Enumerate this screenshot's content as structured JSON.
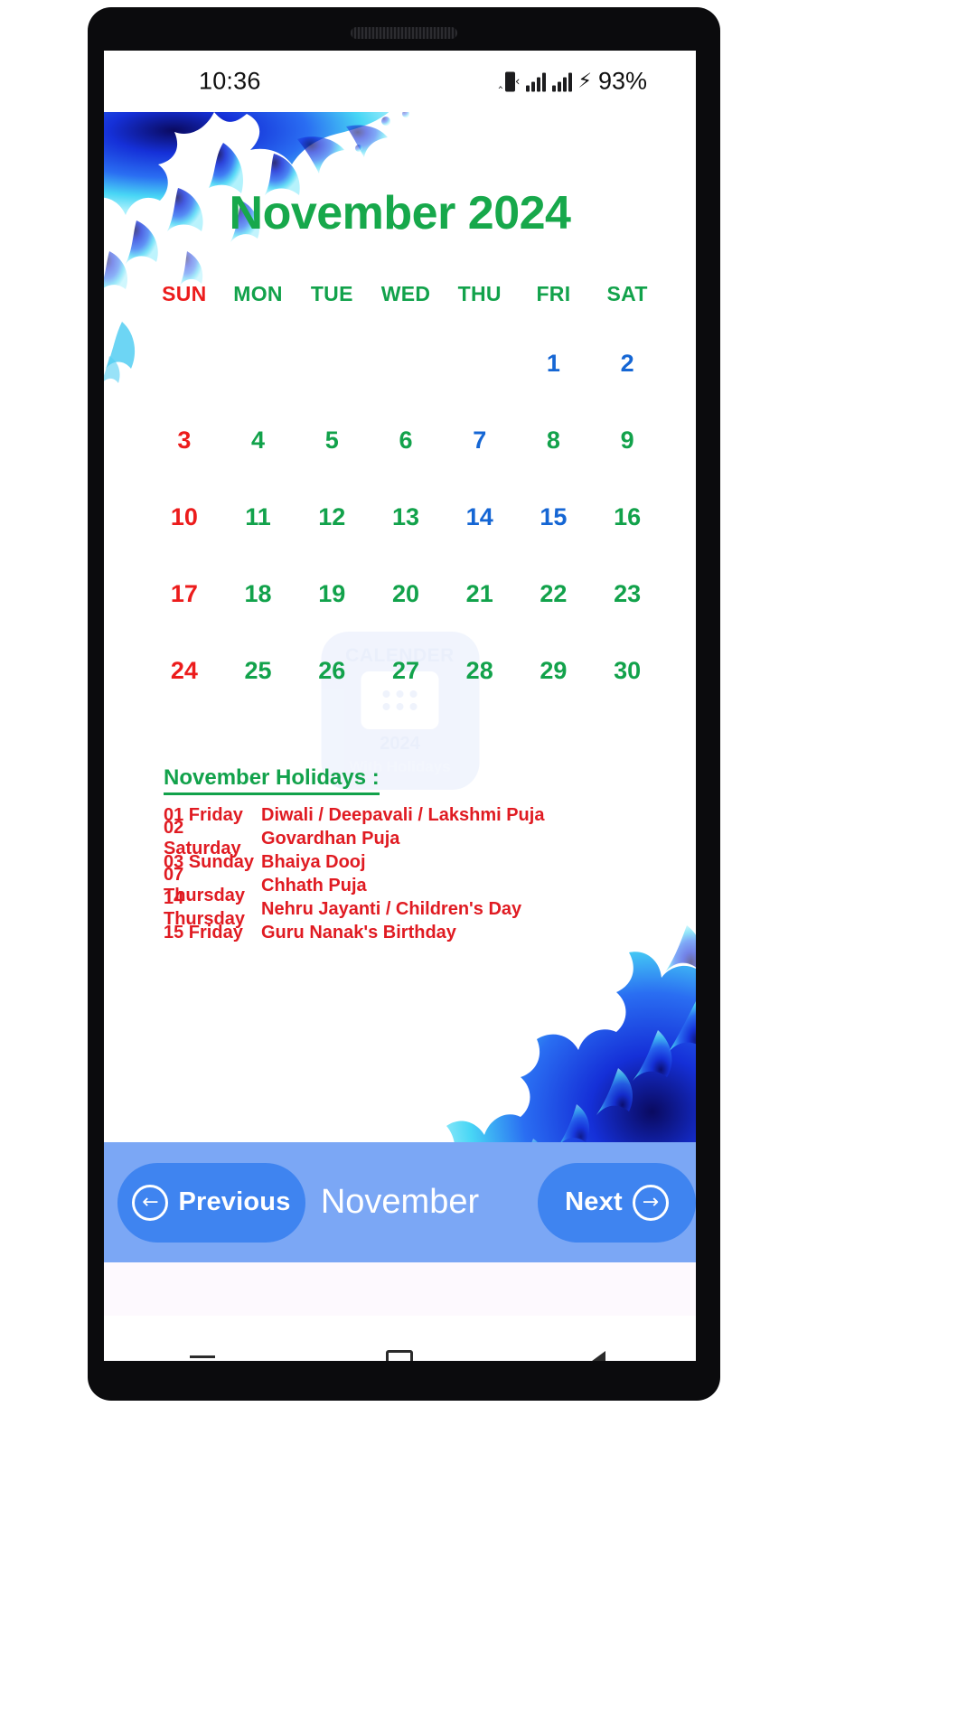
{
  "status_bar": {
    "time": "10:36",
    "battery_percent": "93%",
    "icons": [
      "vibrate-icon",
      "signal-bars-icon",
      "signal-bars-icon",
      "charging-bolt-icon"
    ]
  },
  "calendar": {
    "title": "November 2024",
    "weekdays": [
      {
        "label": "SUN",
        "kind": "sun"
      },
      {
        "label": "MON",
        "kind": "week"
      },
      {
        "label": "TUE",
        "kind": "week"
      },
      {
        "label": "WED",
        "kind": "week"
      },
      {
        "label": "THU",
        "kind": "week"
      },
      {
        "label": "FRI",
        "kind": "week"
      },
      {
        "label": "SAT",
        "kind": "week"
      }
    ],
    "weeks": [
      [
        {
          "d": "",
          "kind": "empty"
        },
        {
          "d": "",
          "kind": "empty"
        },
        {
          "d": "",
          "kind": "empty"
        },
        {
          "d": "",
          "kind": "empty"
        },
        {
          "d": "",
          "kind": "empty"
        },
        {
          "d": "1",
          "kind": "hol"
        },
        {
          "d": "2",
          "kind": "hol"
        }
      ],
      [
        {
          "d": "3",
          "kind": "sun"
        },
        {
          "d": "4",
          "kind": "week"
        },
        {
          "d": "5",
          "kind": "week"
        },
        {
          "d": "6",
          "kind": "week"
        },
        {
          "d": "7",
          "kind": "hol"
        },
        {
          "d": "8",
          "kind": "week"
        },
        {
          "d": "9",
          "kind": "week"
        }
      ],
      [
        {
          "d": "10",
          "kind": "sun"
        },
        {
          "d": "11",
          "kind": "week"
        },
        {
          "d": "12",
          "kind": "week"
        },
        {
          "d": "13",
          "kind": "week"
        },
        {
          "d": "14",
          "kind": "hol"
        },
        {
          "d": "15",
          "kind": "hol"
        },
        {
          "d": "16",
          "kind": "week"
        }
      ],
      [
        {
          "d": "17",
          "kind": "sun"
        },
        {
          "d": "18",
          "kind": "week"
        },
        {
          "d": "19",
          "kind": "week"
        },
        {
          "d": "20",
          "kind": "week"
        },
        {
          "d": "21",
          "kind": "week"
        },
        {
          "d": "22",
          "kind": "week"
        },
        {
          "d": "23",
          "kind": "week"
        }
      ],
      [
        {
          "d": "24",
          "kind": "sun"
        },
        {
          "d": "25",
          "kind": "week"
        },
        {
          "d": "26",
          "kind": "week"
        },
        {
          "d": "27",
          "kind": "week"
        },
        {
          "d": "28",
          "kind": "week"
        },
        {
          "d": "29",
          "kind": "week"
        },
        {
          "d": "30",
          "kind": "week"
        }
      ]
    ],
    "colors": {
      "sunday": "#ec1c1c",
      "weekday": "#12a24b",
      "holiday": "#1566d4",
      "title": "#17a84b"
    }
  },
  "watermark": {
    "top_text": "CALENDER",
    "year": "2024",
    "sub_text": "With Holidays"
  },
  "holidays": {
    "heading": "November Holidays :",
    "rows": [
      {
        "date": "01 Friday",
        "name": "Diwali / Deepavali / Lakshmi Puja"
      },
      {
        "date": "02 Saturday",
        "name": "Govardhan Puja"
      },
      {
        "date": "03 Sunday",
        "name": "Bhaiya Dooj"
      },
      {
        "date": "07 Thursday",
        "name": "Chhath Puja"
      },
      {
        "date": "14 Thursday",
        "name": "Nehru Jayanti / Children's Day"
      },
      {
        "date": "15 Friday",
        "name": "Guru Nanak's Birthday"
      }
    ]
  },
  "bottom_bar": {
    "previous_label": "Previous",
    "month_label": "November",
    "next_label": "Next",
    "bar_color": "#7ba7f5",
    "button_color": "#3f84f0"
  },
  "android_nav": {
    "recents": "menu-icon",
    "home": "home-square-icon",
    "back": "back-triangle-icon"
  }
}
